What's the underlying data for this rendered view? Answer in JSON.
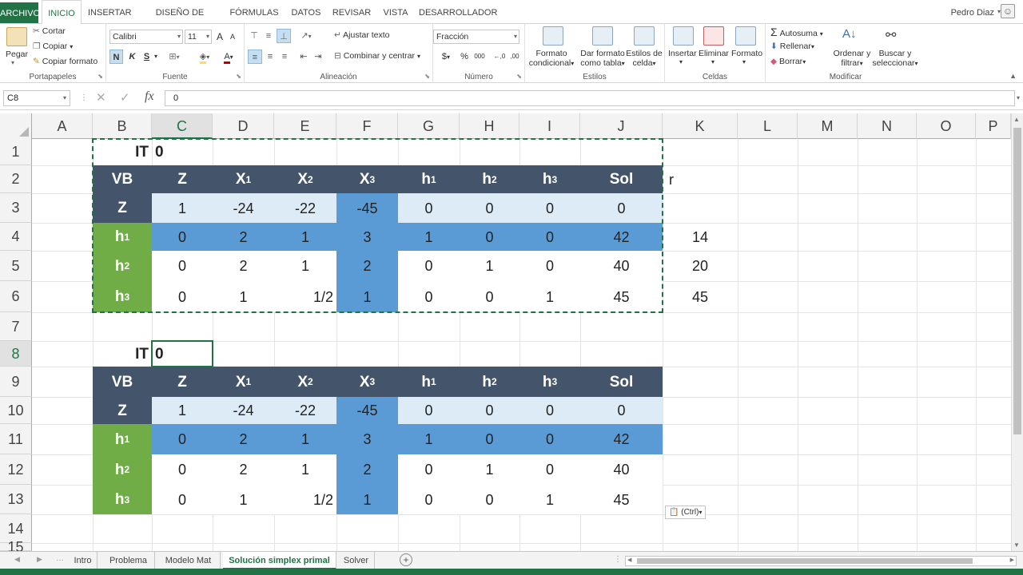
{
  "ribbon_tabs": [
    "ARCHIVO",
    "INICIO",
    "INSERTAR",
    "DISEÑO DE PÁGINA",
    "FÓRMULAS",
    "DATOS",
    "REVISAR",
    "VISTA",
    "DESARROLLADOR"
  ],
  "user": {
    "name": "Pedro Diaz"
  },
  "clipboard": {
    "paste_label": "Pegar",
    "cut": "Cortar",
    "copy": "Copiar",
    "format_painter": "Copiar formato",
    "group": "Portapapeles"
  },
  "font": {
    "family": "Calibri",
    "size": "11",
    "bold": "N",
    "italic": "K",
    "underline": "S",
    "grow": "A",
    "shrink": "A",
    "color_letter": "A",
    "group": "Fuente"
  },
  "alignment": {
    "wrap": "Ajustar texto",
    "merge": "Combinar y centrar",
    "group": "Alineación"
  },
  "number": {
    "format": "Fracción",
    "currency": "$",
    "percent": "%",
    "thousands": "000",
    "inc_decimals": "←,0",
    "dec_decimals": ",00",
    "group": "Número"
  },
  "styles": {
    "conditional": "Formato condicional",
    "as_table": "Dar formato como tabla",
    "cell_styles": "Estilos de celda",
    "group": "Estilos"
  },
  "cells": {
    "insert": "Insertar",
    "delete": "Eliminar",
    "format": "Formato",
    "group": "Celdas"
  },
  "editing": {
    "autosum": "Autosuma",
    "fill": "Rellenar",
    "clear": "Borrar",
    "sort": "Ordenar y filtrar",
    "find": "Buscar y seleccionar",
    "group": "Modificar"
  },
  "formula_bar": {
    "name_box": "C8",
    "fx": "fx",
    "value": "0"
  },
  "columns": [
    "A",
    "B",
    "C",
    "D",
    "E",
    "F",
    "G",
    "H",
    "I",
    "J",
    "K",
    "L",
    "M",
    "N",
    "O",
    "P"
  ],
  "rows": [
    "1",
    "2",
    "3",
    "4",
    "5",
    "6",
    "7",
    "8",
    "9",
    "10",
    "11",
    "12",
    "13",
    "14",
    "15"
  ],
  "selected": {
    "column": "C",
    "row": "8"
  },
  "stray_text": "r",
  "tableau1": {
    "it_label": "IT",
    "it_value": "0",
    "headers": [
      "VB",
      "Z",
      "X",
      "X",
      "X",
      "h",
      "h",
      "h",
      "Sol"
    ],
    "header_subs": [
      "",
      "",
      "1",
      "2",
      "3",
      "1",
      "2",
      "3",
      ""
    ],
    "rows": [
      {
        "vb": "Z",
        "vb_sub": "",
        "vals": [
          "1",
          "-24",
          "-22",
          "-45",
          "0",
          "0",
          "0",
          "0"
        ]
      },
      {
        "vb": "h",
        "vb_sub": "1",
        "vals": [
          "0",
          "2",
          "1",
          "3",
          "1",
          "0",
          "0",
          "42"
        ]
      },
      {
        "vb": "h",
        "vb_sub": "2",
        "vals": [
          "0",
          "2",
          "1",
          "2",
          "0",
          "1",
          "0",
          "40"
        ]
      },
      {
        "vb": "h",
        "vb_sub": "3",
        "vals": [
          "0",
          "1",
          "1/2",
          "1",
          "0",
          "0",
          "1",
          "45"
        ]
      }
    ],
    "ratios": [
      "14",
      "20",
      "45"
    ]
  },
  "tableau2": {
    "it_label": "IT",
    "it_value": "0",
    "headers": [
      "VB",
      "Z",
      "X",
      "X",
      "X",
      "h",
      "h",
      "h",
      "Sol"
    ],
    "header_subs": [
      "",
      "",
      "1",
      "2",
      "3",
      "1",
      "2",
      "3",
      ""
    ],
    "rows": [
      {
        "vb": "Z",
        "vb_sub": "",
        "vals": [
          "1",
          "-24",
          "-22",
          "-45",
          "0",
          "0",
          "0",
          "0"
        ]
      },
      {
        "vb": "h",
        "vb_sub": "1",
        "vals": [
          "0",
          "2",
          "1",
          "3",
          "1",
          "0",
          "0",
          "42"
        ]
      },
      {
        "vb": "h",
        "vb_sub": "2",
        "vals": [
          "0",
          "2",
          "1",
          "2",
          "0",
          "1",
          "0",
          "40"
        ]
      },
      {
        "vb": "h",
        "vb_sub": "3",
        "vals": [
          "0",
          "1",
          "1/2",
          "1",
          "0",
          "0",
          "1",
          "45"
        ]
      }
    ]
  },
  "paste_options": "(Ctrl)",
  "sheet_tabs": [
    "Intro",
    "Problema",
    "Modelo Mat",
    "Solución simplex primal",
    "Solver"
  ],
  "active_sheet": "Solución simplex primal",
  "colors": {
    "excel_green": "#217346",
    "header_navy": "#44546a",
    "pivot_blue": "#5b9bd5",
    "light_blue": "#ddebf7",
    "basis_green": "#70ad47"
  }
}
